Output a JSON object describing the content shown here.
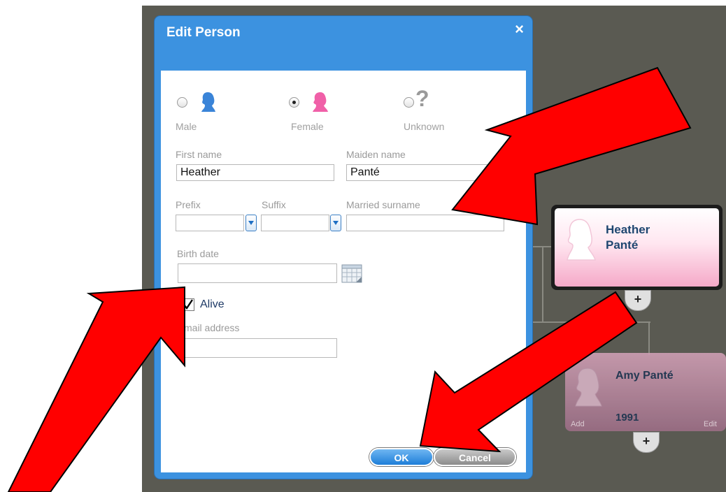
{
  "dialog": {
    "title": "Edit Person",
    "close_label": "×",
    "gender": {
      "male_label": "Male",
      "female_label": "Female",
      "unknown_label": "Unknown",
      "unknown_glyph": "?",
      "selected": "Female"
    },
    "fields": {
      "first_name_label": "First name",
      "first_name_value": "Heather",
      "maiden_name_label": "Maiden name",
      "maiden_name_value": "Panté",
      "prefix_label": "Prefix",
      "prefix_value": "",
      "suffix_label": "Suffix",
      "suffix_value": "",
      "married_surname_label": "Married surname",
      "married_surname_value": "",
      "birth_date_label": "Birth date",
      "birth_date_value": "",
      "alive_label": "Alive",
      "alive_checked": true,
      "email_label": "mail address",
      "email_value": ""
    },
    "buttons": {
      "ok_label": "OK",
      "cancel_label": "Cancel"
    }
  },
  "tree": {
    "selected_card": {
      "first": "Heather",
      "last": "Panté"
    },
    "child_card": {
      "name": "Amy Panté",
      "year": "1991",
      "add_label": "Add",
      "edit_label": "Edit"
    },
    "plus_glyph": "+"
  },
  "colors": {
    "dialog_blue": "#3c92e0",
    "annotation_red": "#ff0000",
    "female_pink": "#f060a8",
    "male_blue": "#3a84d8"
  }
}
